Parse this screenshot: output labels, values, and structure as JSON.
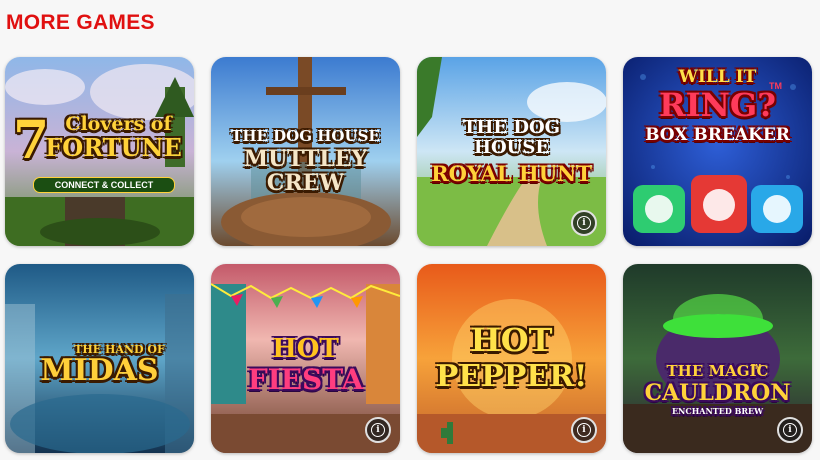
{
  "section": {
    "title": "MORE GAMES",
    "title_color": "#e01010"
  },
  "games": [
    {
      "line1": "7",
      "line2": "Clovers of",
      "line3": "FORTUNE",
      "badge": "CONNECT & COLLECT"
    },
    {
      "line1": "THE DOG HOUSE",
      "line2": "MUTTLEY",
      "line3": "CREW"
    },
    {
      "line1": "THE DOG",
      "line2": "HOUSE",
      "line3": "ROYAL HUNT"
    },
    {
      "line1": "WILL IT",
      "line2": "RING?",
      "line3": "BOX BREAKER",
      "tm": "TM"
    },
    {
      "line1": "THE HAND OF",
      "line2": "MIDAS"
    },
    {
      "line1": "HOT",
      "line2": "FIESTA"
    },
    {
      "line1": "HOT",
      "line2": "PEPPER!"
    },
    {
      "line1": "THE MAGIC",
      "line2": "CAULDRON",
      "line3": "ENCHANTED BREW",
      "tm": "TM"
    }
  ],
  "info_icon": "info-icon",
  "info_glyph": "i"
}
